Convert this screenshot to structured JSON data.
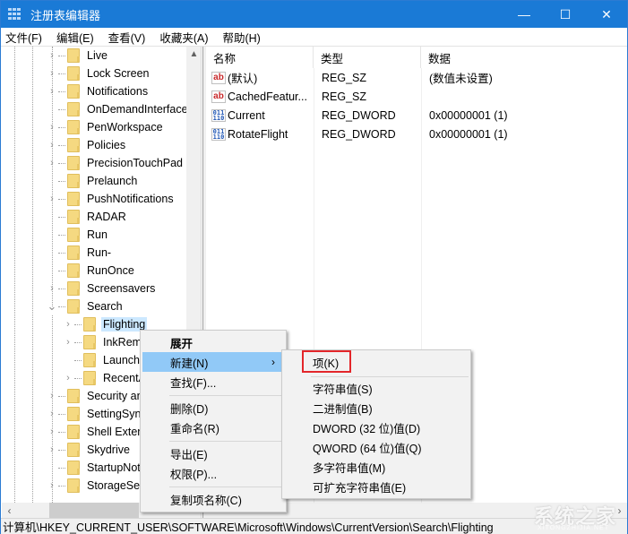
{
  "window": {
    "title": "注册表编辑器",
    "controls": {
      "minimize": "—",
      "maximize": "☐",
      "close": "✕"
    }
  },
  "menubar": [
    "文件(F)",
    "编辑(E)",
    "查看(V)",
    "收藏夹(A)",
    "帮助(H)"
  ],
  "tree": {
    "items": [
      {
        "label": "Live",
        "expandable": true,
        "level": 1
      },
      {
        "label": "Lock Screen",
        "expandable": true,
        "level": 1
      },
      {
        "label": "Notifications",
        "expandable": true,
        "level": 1
      },
      {
        "label": "OnDemandInterfaceC",
        "expandable": false,
        "level": 1
      },
      {
        "label": "PenWorkspace",
        "expandable": true,
        "level": 1
      },
      {
        "label": "Policies",
        "expandable": true,
        "level": 1
      },
      {
        "label": "PrecisionTouchPad",
        "expandable": true,
        "level": 1
      },
      {
        "label": "Prelaunch",
        "expandable": false,
        "level": 1
      },
      {
        "label": "PushNotifications",
        "expandable": true,
        "level": 1
      },
      {
        "label": "RADAR",
        "expandable": false,
        "level": 1
      },
      {
        "label": "Run",
        "expandable": false,
        "level": 1
      },
      {
        "label": "Run-",
        "expandable": false,
        "level": 1
      },
      {
        "label": "RunOnce",
        "expandable": false,
        "level": 1
      },
      {
        "label": "Screensavers",
        "expandable": true,
        "level": 1
      },
      {
        "label": "Search",
        "expandable": true,
        "expanded": true,
        "level": 1
      },
      {
        "label": "Flighting",
        "expandable": true,
        "level": 2,
        "selected": true
      },
      {
        "label": "InkReminder",
        "expandable": true,
        "level": 2
      },
      {
        "label": "Launch",
        "expandable": false,
        "level": 2
      },
      {
        "label": "RecentApps",
        "expandable": true,
        "level": 2
      },
      {
        "label": "Security and Maintenance",
        "expandable": true,
        "level": 1
      },
      {
        "label": "SettingSync",
        "expandable": true,
        "level": 1
      },
      {
        "label": "Shell Extensions",
        "expandable": true,
        "level": 1
      },
      {
        "label": "Skydrive",
        "expandable": true,
        "level": 1
      },
      {
        "label": "StartupNotify",
        "expandable": false,
        "level": 1
      },
      {
        "label": "StorageSense",
        "expandable": true,
        "level": 1
      }
    ]
  },
  "list": {
    "headers": [
      "名称",
      "类型",
      "数据"
    ],
    "rows": [
      {
        "icon": "string-value-icon",
        "name": "(默认)",
        "type": "REG_SZ",
        "data": "(数值未设置)"
      },
      {
        "icon": "string-value-icon",
        "name": "CachedFeatur...",
        "type": "REG_SZ",
        "data": ""
      },
      {
        "icon": "binary-value-icon",
        "name": "Current",
        "type": "REG_DWORD",
        "data": "0x00000001 (1)"
      },
      {
        "icon": "binary-value-icon",
        "name": "RotateFlight",
        "type": "REG_DWORD",
        "data": "0x00000001 (1)"
      }
    ]
  },
  "context_menu": {
    "items": [
      {
        "label": "展开",
        "bold": true
      },
      {
        "label": "新建(N)",
        "submenu": true,
        "hover": true
      },
      {
        "label": "查找(F)..."
      },
      {
        "label": "删除(D)"
      },
      {
        "label": "重命名(R)"
      },
      {
        "label": "导出(E)"
      },
      {
        "label": "权限(P)..."
      },
      {
        "label": "复制项名称(C)"
      }
    ],
    "submenu_arrow": "›"
  },
  "submenu": {
    "items": [
      {
        "label": "项(K)",
        "highlighted": true
      },
      {
        "label": "字符串值(S)"
      },
      {
        "label": "二进制值(B)"
      },
      {
        "label": "DWORD (32 位)值(D)"
      },
      {
        "label": "QWORD (64 位)值(Q)"
      },
      {
        "label": "多字符串值(M)"
      },
      {
        "label": "可扩充字符串值(E)"
      }
    ],
    "highlight_color": "#e3262a"
  },
  "statusbar": {
    "path": "计算机\\HKEY_CURRENT_USER\\SOFTWARE\\Microsoft\\Windows\\CurrentVersion\\Search\\Flighting"
  },
  "watermark": {
    "text": "系统之家",
    "sub": "XITONGZHIJIA.NET"
  },
  "colors": {
    "titlebar": "#1a7ad6",
    "selection": "#cce8ff",
    "menu_hover": "#91c9f7"
  }
}
